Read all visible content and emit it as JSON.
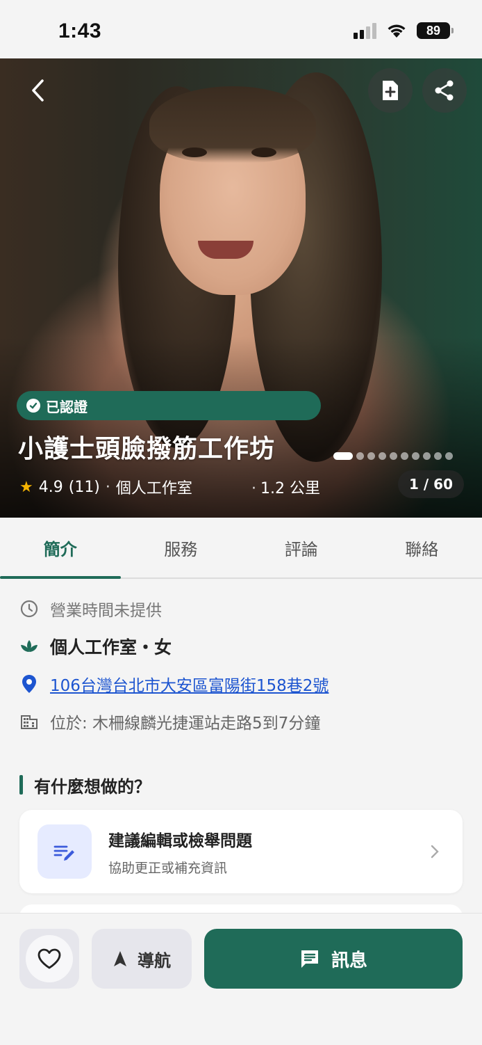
{
  "status_bar": {
    "time": "1:43",
    "battery": "89"
  },
  "hero": {
    "verified_label": "已認證",
    "title": "小護士頭臉撥筋工作坊",
    "rating": "4.9",
    "review_count": "(11)",
    "category": "個人工作室",
    "distance": "1.2 公里",
    "photo_counter": "1 / 60",
    "dot_count": 10
  },
  "tabs": [
    {
      "label": "簡介",
      "active": true
    },
    {
      "label": "服務",
      "active": false
    },
    {
      "label": "評論",
      "active": false
    },
    {
      "label": "聯絡",
      "active": false
    }
  ],
  "info": {
    "hours": "營業時間未提供",
    "type": "個人工作室・女",
    "address": "106台灣台北市大安區富陽街158巷2號",
    "station": "位於: 木柵線麟光捷運站走路5到7分鐘"
  },
  "section": {
    "title": "有什麼想做的？",
    "card": {
      "title": "建議編輯或檢舉問題",
      "subtitle": "協助更正或補充資訊"
    }
  },
  "bottom_bar": {
    "nav_label": "導航",
    "message_label": "訊息"
  },
  "colors": {
    "brand_green": "#1f6b58",
    "link_blue": "#1d55d0",
    "star": "#f5b301"
  }
}
